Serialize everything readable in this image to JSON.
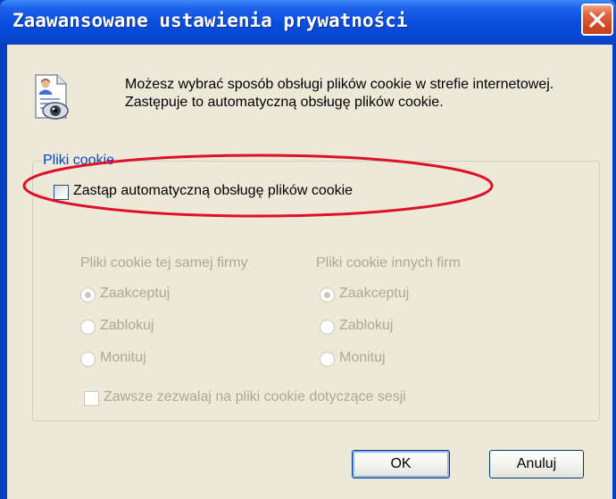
{
  "window": {
    "title": "Zaawansowane ustawienia prywatności",
    "close_icon": "close-icon"
  },
  "description": {
    "icon": "privacy-document-eye-icon",
    "text": "Możesz wybrać sposób obsługi plików cookie w strefie internetowej. Zastępuje to automatyczną obsługę plików cookie."
  },
  "cookies_group": {
    "label": "Pliki cookie",
    "override": {
      "label": "Zastąp automatyczną obsługę plików cookie",
      "checked": false,
      "highlighted_by_red_ellipse": true
    },
    "first_party": {
      "heading": "Pliki cookie tej samej firmy",
      "options": [
        "Zaakceptuj",
        "Zablokuj",
        "Monituj"
      ],
      "selected": "Zaakceptuj",
      "enabled": false
    },
    "third_party": {
      "heading": "Pliki cookie innych firm",
      "options": [
        "Zaakceptuj",
        "Zablokuj",
        "Monituj"
      ],
      "selected": "Zaakceptuj",
      "enabled": false
    },
    "session": {
      "label": "Zawsze zezwalaj na pliki cookie dotyczące sesji",
      "checked": false,
      "enabled": false
    }
  },
  "buttons": {
    "ok": "OK",
    "cancel": "Anuluj"
  },
  "colors": {
    "titlebar": "#0a4ee0",
    "dialog_bg": "#ece9d8",
    "group_label": "#0046d5",
    "disabled_text": "#aca899",
    "highlight_ellipse": "#e0102a"
  }
}
